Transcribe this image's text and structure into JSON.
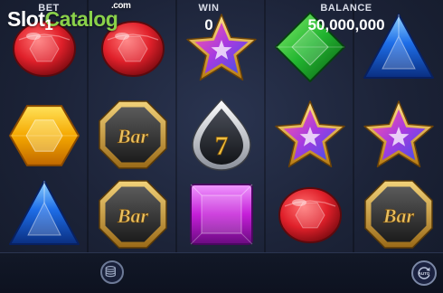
{
  "logo": {
    "brand_left": "Slot",
    "brand_right": "Catalog",
    "tld": ".com"
  },
  "reels": [
    [
      "ruby",
      "topaz",
      "sapphire"
    ],
    [
      "ruby",
      "bar",
      "bar"
    ],
    [
      "star",
      "seven",
      "amethyst"
    ],
    [
      "emerald",
      "star",
      "ruby"
    ],
    [
      "sapphire",
      "star",
      "bar"
    ]
  ],
  "symbol_text": {
    "bar": "Bar",
    "seven": "7"
  },
  "bottom_bar": {
    "bet_label": "BET",
    "bet_value": "1",
    "win_label": "WIN",
    "win_value": "0",
    "balance_label": "BALANCE",
    "balance_value": "50,000,000",
    "auto_label": "AUTO"
  },
  "icons": {
    "coins": "coin-stack-icon",
    "auto": "autoplay-icon"
  },
  "colors": {
    "ruby": "#e0202a",
    "topaz": "#f5a800",
    "sapphire": "#1e6ee8",
    "emerald": "#22b530",
    "amethyst": "#c51fd8",
    "star_gold": "#f2c242",
    "brand_green": "#8ad14a"
  }
}
